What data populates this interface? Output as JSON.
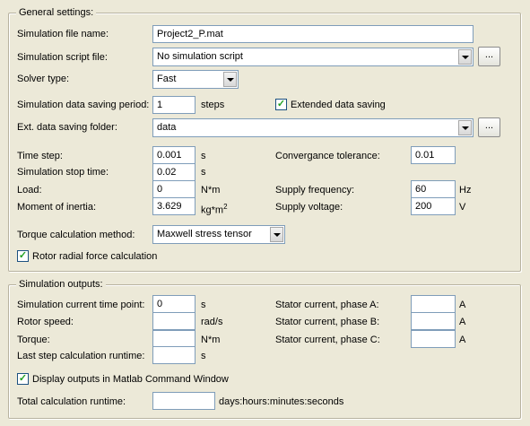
{
  "general": {
    "legend": "General settings:",
    "sim_file_name_label": "Simulation file name:",
    "sim_file_name_value": "Project2_P.mat",
    "sim_script_label": "Simulation script file:",
    "sim_script_value": "No simulation script",
    "browse_label": "...",
    "solver_type_label": "Solver type:",
    "solver_type_value": "Fast",
    "saving_period_label": "Simulation data saving period:",
    "saving_period_value": "1",
    "saving_period_unit": "steps",
    "extended_saving_label": "Extended data saving",
    "extended_saving_checked": true,
    "ext_folder_label": "Ext. data saving folder:",
    "ext_folder_value": "data",
    "time_step_label": "Time step:",
    "time_step_value": "0.001",
    "time_step_unit": "s",
    "stop_time_label": "Simulation stop time:",
    "stop_time_value": "0.02",
    "stop_time_unit": "s",
    "load_label": "Load:",
    "load_value": "0",
    "load_unit": "N*m",
    "inertia_label": "Moment of inertia:",
    "inertia_value": "3.629",
    "inertia_unit": "kg*m",
    "inertia_unit_sup": "2",
    "tolerance_label": "Convergance tolerance:",
    "tolerance_value": "0.01",
    "supply_freq_label": "Supply frequency:",
    "supply_freq_value": "60",
    "supply_freq_unit": "Hz",
    "supply_volt_label": "Supply voltage:",
    "supply_volt_value": "200",
    "supply_volt_unit": "V",
    "torque_method_label": "Torque calculation method:",
    "torque_method_value": "Maxwell stress tensor",
    "radial_force_label": "Rotor radial force calculation",
    "radial_force_checked": true
  },
  "outputs": {
    "legend": "Simulation outputs:",
    "current_time_label": "Simulation current time point:",
    "current_time_value": "0",
    "current_time_unit": "s",
    "rotor_speed_label": "Rotor speed:",
    "rotor_speed_value": "",
    "rotor_speed_unit": "rad/s",
    "torque_label": "Torque:",
    "torque_value": "",
    "torque_unit": "N*m",
    "last_step_label": "Last step calculation runtime:",
    "last_step_value": "",
    "last_step_unit": "s",
    "phase_a_label": "Stator current, phase A:",
    "phase_a_value": "",
    "phase_a_unit": "A",
    "phase_b_label": "Stator current, phase B:",
    "phase_b_value": "",
    "phase_b_unit": "A",
    "phase_c_label": "Stator current, phase C:",
    "phase_c_value": "",
    "phase_c_unit": "A",
    "display_matlab_label": "Display outputs in Matlab Command Window",
    "display_matlab_checked": true,
    "total_runtime_label": "Total calculation runtime:",
    "total_runtime_value": "",
    "total_runtime_unit": "days:hours:minutes:seconds"
  }
}
